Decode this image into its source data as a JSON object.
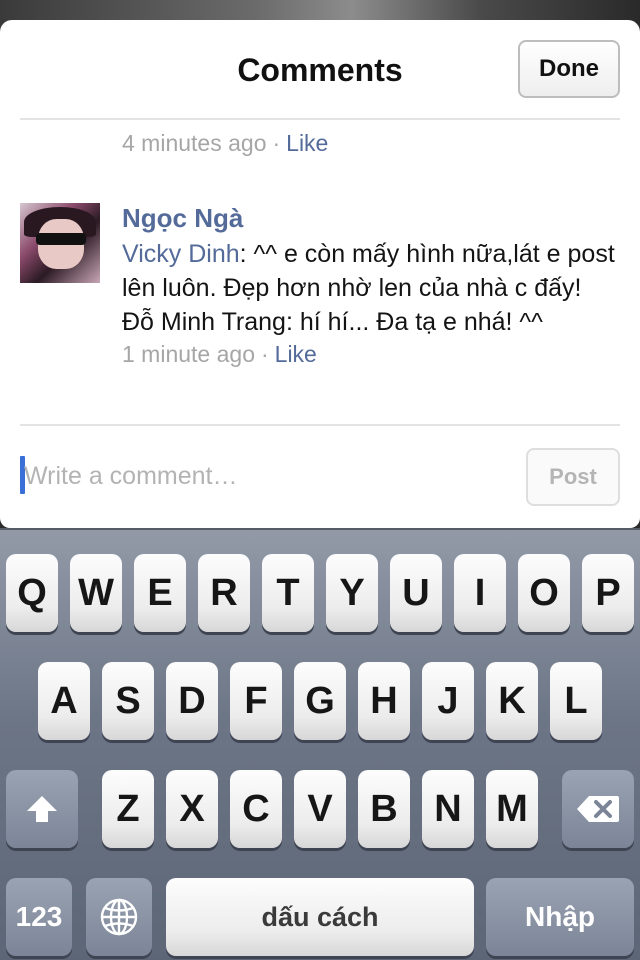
{
  "header": {
    "title": "Comments",
    "done_label": "Done"
  },
  "previous_comment": {
    "time": "4 minutes ago",
    "separator": "·",
    "like_label": "Like"
  },
  "comment": {
    "author": "Ngọc Ngà",
    "lines": [
      {
        "mention": "Vicky Dinh",
        "text": ": ^^ e còn mấy hình nữa,lát e post lên luôn. Đẹp hơn nhờ len của nhà c đấy!"
      },
      {
        "mention": "",
        "text": "Đỗ Minh Trang: hí hí... Đa tạ e nhá! ^^"
      }
    ],
    "time": "1 minute ago",
    "separator": "·",
    "like_label": "Like"
  },
  "composer": {
    "placeholder": "Write a comment…",
    "post_label": "Post"
  },
  "keyboard": {
    "row1": [
      "Q",
      "W",
      "E",
      "R",
      "T",
      "Y",
      "U",
      "I",
      "O",
      "P"
    ],
    "row2": [
      "A",
      "S",
      "D",
      "F",
      "G",
      "H",
      "J",
      "K",
      "L"
    ],
    "row3": [
      "Z",
      "X",
      "C",
      "V",
      "B",
      "N",
      "M"
    ],
    "numbers_label": "123",
    "space_label": "dấu cách",
    "return_label": "Nhập",
    "icons": {
      "shift": "shift-icon",
      "delete": "backspace-icon",
      "globe": "globe-icon"
    }
  },
  "colors": {
    "link": "#546b9a",
    "cursor": "#3b6fd8",
    "meta": "#a6a6a6"
  }
}
